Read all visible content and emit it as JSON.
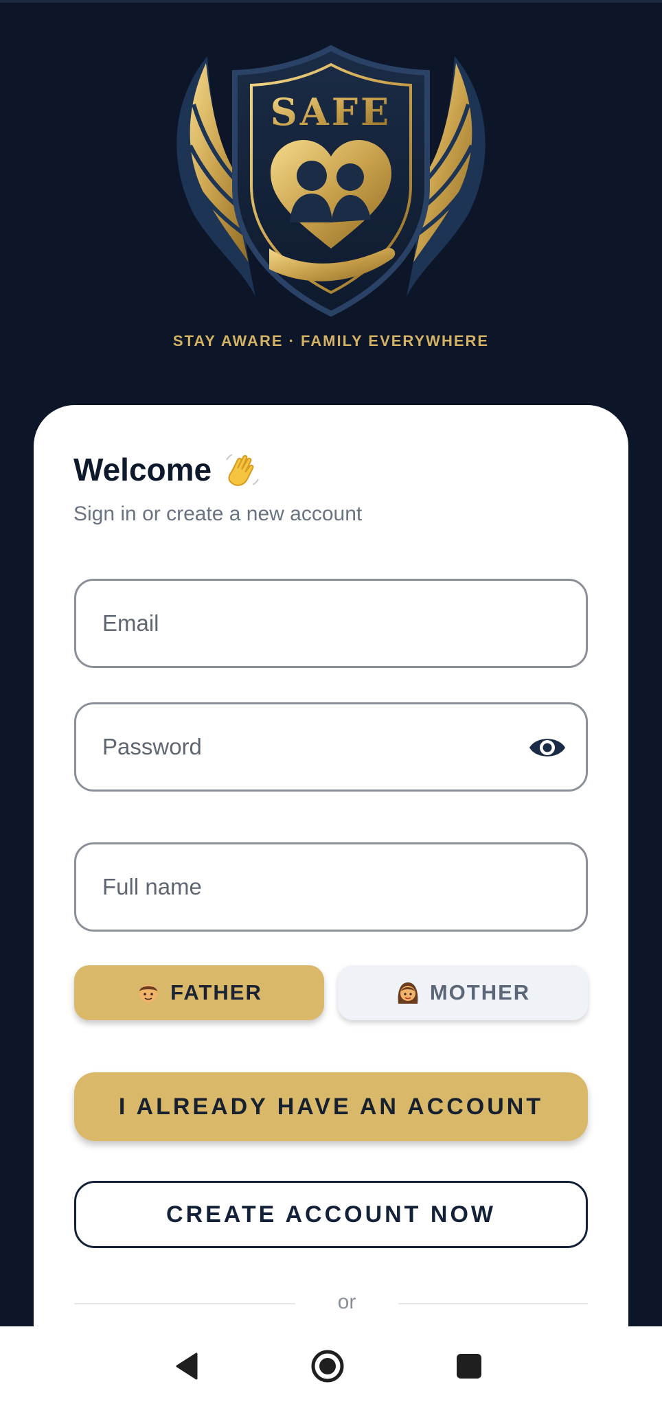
{
  "brand": {
    "logo_text": "SAFE",
    "tagline": "STAY AWARE · FAMILY EVERYWHERE",
    "colors": {
      "navy": "#0c1628",
      "gold": "#d9b86a",
      "white": "#ffffff"
    }
  },
  "card": {
    "title": "Welcome",
    "title_icon": "waving-hand-icon",
    "subtitle": "Sign in or create a new account"
  },
  "form": {
    "email": {
      "placeholder": "Email",
      "value": ""
    },
    "password": {
      "placeholder": "Password",
      "value": "",
      "toggle_icon": "eye-icon"
    },
    "full_name": {
      "placeholder": "Full name",
      "value": ""
    }
  },
  "roles": {
    "father": {
      "label": "FATHER",
      "icon": "man-emoji-icon",
      "selected": true
    },
    "mother": {
      "label": "MOTHER",
      "icon": "woman-emoji-icon",
      "selected": false
    }
  },
  "actions": {
    "sign_in_label": "I ALREADY HAVE AN ACCOUNT",
    "create_label": "CREATE ACCOUNT NOW",
    "divider_label": "or"
  },
  "system_nav": {
    "back_icon": "back-triangle-icon",
    "home_icon": "home-circle-icon",
    "recents_icon": "recents-square-icon"
  }
}
